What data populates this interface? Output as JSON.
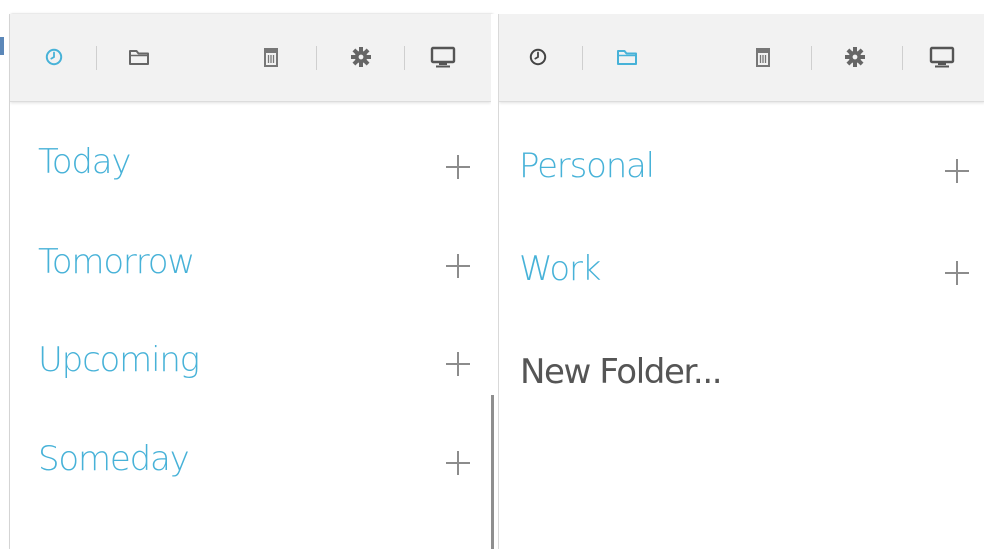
{
  "colors": {
    "accent": "#47b2d8",
    "icon_gray": "#666666",
    "toolbar_bg": "#f2f2f2",
    "plus_gray": "#8c8c8c",
    "text_gray": "#555555"
  },
  "left_panel": {
    "toolbar": {
      "icons": [
        "clock-icon",
        "folder-icon",
        "trash-icon",
        "gear-icon",
        "monitor-icon"
      ],
      "active": "clock-icon"
    },
    "items": [
      {
        "label": "Today"
      },
      {
        "label": "Tomorrow"
      },
      {
        "label": "Upcoming"
      },
      {
        "label": "Someday"
      }
    ]
  },
  "right_panel": {
    "toolbar": {
      "icons": [
        "clock-icon",
        "folder-icon",
        "trash-icon",
        "gear-icon",
        "monitor-icon"
      ],
      "active": "folder-icon"
    },
    "folders": [
      {
        "label": "Personal"
      },
      {
        "label": "Work"
      }
    ],
    "new_folder_label": "New Folder..."
  }
}
